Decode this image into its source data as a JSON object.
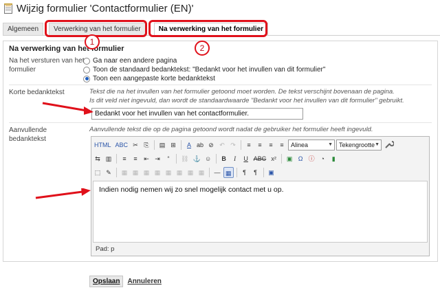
{
  "page": {
    "title": "Wijzig formulier 'Contactformulier (EN)'"
  },
  "tabs": [
    {
      "label": "Algemeen"
    },
    {
      "label": "Verwerking van het formulier"
    },
    {
      "label": "Na verwerking van het formulier"
    }
  ],
  "annotations": {
    "badge1": "1",
    "badge2": "2"
  },
  "section": {
    "heading": "Na verwerking van het formulier",
    "on_submit": {
      "label": "Na het versturen van het formulier",
      "options": [
        {
          "label": "Ga naar een andere pagina",
          "checked": false
        },
        {
          "label": "Toon de standaard bedanktekst: \"Bedankt voor het invullen van dit formulier\"",
          "checked": false
        },
        {
          "label": "Toon een aangepaste korte bedanktekst",
          "checked": true
        }
      ]
    },
    "short_text": {
      "label": "Korte bedanktekst",
      "hint_line1": "Tekst die na het invullen van het formulier getoond moet worden. De tekst verschijnt bovenaan de pagina.",
      "hint_line2": "Is dit veld niet ingevuld, dan wordt de standaardwaarde \"Bedankt voor het invullen van dit formulier\" gebruikt.",
      "value": "Bedankt voor het invullen van het contactformulier."
    },
    "additional_text": {
      "label": "Aanvullende bedanktekst",
      "hint": "Aanvullende tekst die op de pagina getoond wordt nadat de gebruiker het formulier heeft ingevuld.",
      "content": "Indien nodig nemen wij zo snel mogelijk contact met u op.",
      "path": "Pad: p"
    }
  },
  "editor": {
    "format_select": "Alinea",
    "size_select": "Tekengrootte",
    "row1": [
      "HTML",
      "ABC",
      "✂",
      "⎘",
      "▤",
      "⊞",
      "A",
      "ab",
      "⊘",
      "↶",
      "↷",
      "≡",
      "≡",
      "≡",
      "≡"
    ],
    "row2": [
      "⇆",
      "▥",
      "≡",
      "≡",
      "⇤",
      "⇥",
      "“",
      "⛓",
      "⚓",
      "☺",
      "B",
      "I",
      "U",
      "ABC",
      "x²",
      "▣",
      "Ω",
      "ⓘ",
      "◔",
      "▮"
    ],
    "row3": [
      "⬚",
      "✎",
      "▦",
      "▦",
      "▦",
      "▦",
      "▦",
      "▦",
      "▦",
      "▦",
      "—",
      "▦",
      "¶",
      "¶",
      "▣"
    ]
  },
  "footer": {
    "save": "Opslaan",
    "cancel": "Annuleren"
  },
  "colors": {
    "callout": "#e0101a",
    "accent": "#1f5fbf"
  }
}
